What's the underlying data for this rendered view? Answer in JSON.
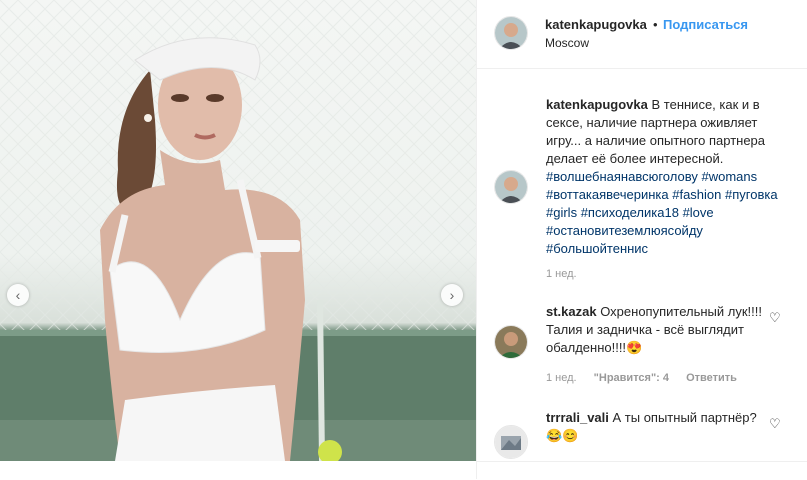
{
  "post": {
    "username": "katenkapugovka",
    "dot": "•",
    "follow_label": "Подписаться",
    "location": "Moscow"
  },
  "caption": {
    "username": "katenkapugovka",
    "text": "В теннисе, как и в сексе, наличие партнера оживляет игру... а наличие опытного партнера делает её более интересной.",
    "tags": [
      "#волшебнаянавсюголову",
      "#womans",
      "#воттакаявечеринка",
      "#fashion",
      "#пуговка",
      "#girls",
      "#психоделика18",
      "#love",
      "#остановитеземлюясойду",
      "#большойтеннис"
    ],
    "time": "1 нед."
  },
  "comments": [
    {
      "username": "st.kazak",
      "text": "Охренопупительный лук!!!! Талия и задничка - всё выглядит обалденно!!!!😍",
      "time": "1 нед.",
      "likes": "\"Нравится\": 4",
      "reply": "Ответить"
    },
    {
      "username": "trrrali_vali",
      "text": "А ты опытный партнёр?😂😊"
    }
  ],
  "icons": {
    "prev": "chevron-left-icon",
    "next": "chevron-right-icon",
    "like": "heart-outline-icon"
  },
  "colors": {
    "link": "#3897f0",
    "hashtag": "#003569",
    "muted": "#999999"
  }
}
